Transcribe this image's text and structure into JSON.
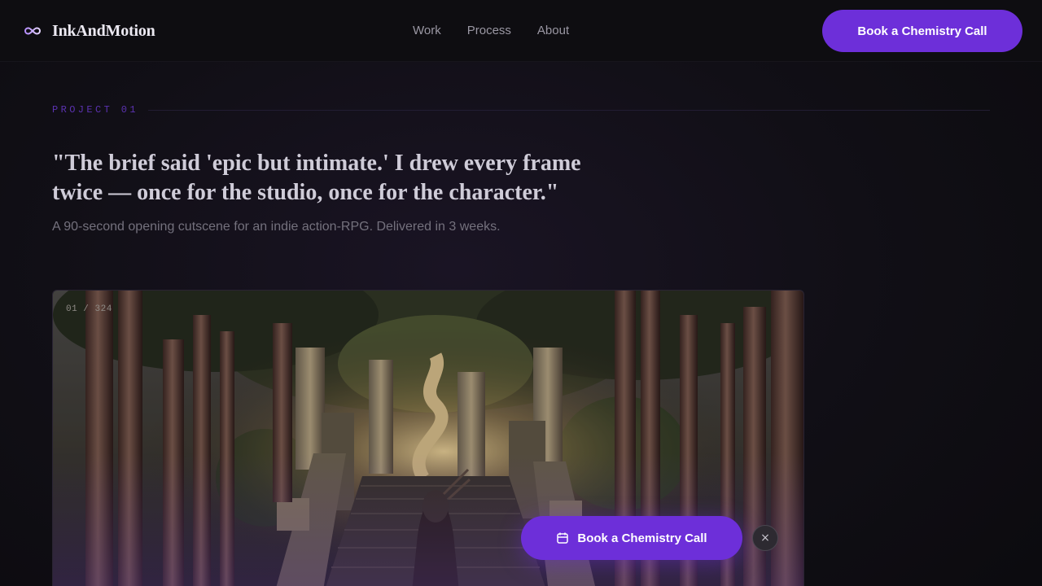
{
  "header": {
    "brand_name": "InkAndMotion",
    "logo_icon": "infinity-icon",
    "nav": [
      {
        "label": "Work"
      },
      {
        "label": "Process"
      },
      {
        "label": "About"
      }
    ],
    "cta_label": "Book a Chemistry Call"
  },
  "project": {
    "label": "PROJECT 01",
    "quote": "\"The brief said 'epic but intimate.' I drew every frame twice — once for the studio, once for the character.\"",
    "subtitle": "A 90-second opening cutscene for an indie action-RPG. Delivered in 3 weeks.",
    "frame_counter": "01 / 324"
  },
  "floating_cta": {
    "label": "Book a Chemistry Call",
    "icon": "calendar-icon",
    "close_icon": "close-icon",
    "close_label": "×"
  },
  "colors": {
    "accent": "#6d2fd9",
    "background": "#0d0c10",
    "project_label": "#5b32b0"
  }
}
